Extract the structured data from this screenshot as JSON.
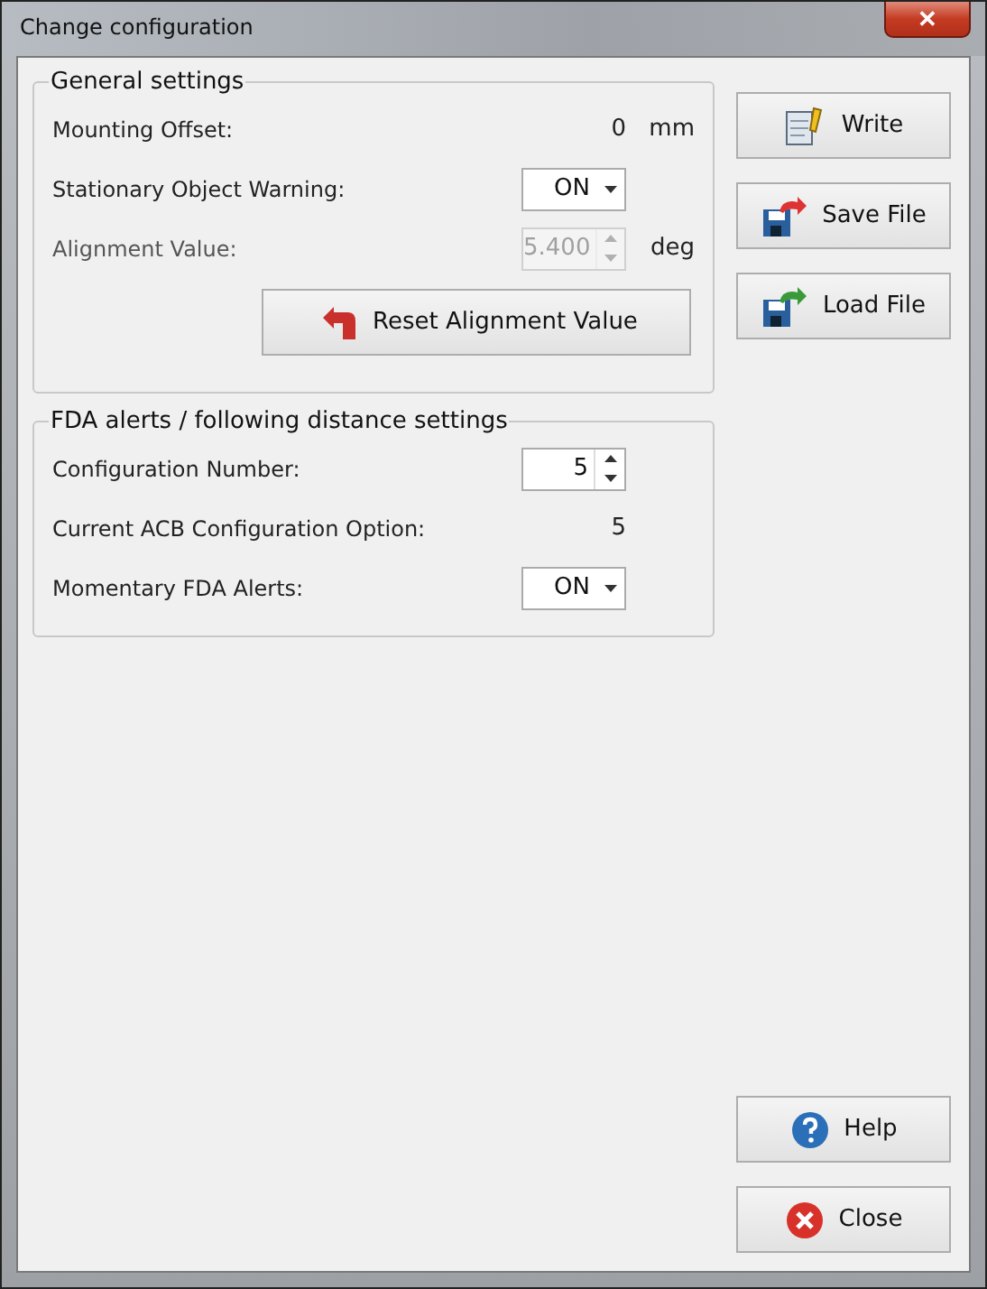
{
  "window": {
    "title": "Change configuration",
    "close_glyph": "✕"
  },
  "general_settings": {
    "title": "General settings",
    "rows": [
      {
        "kind": "readout",
        "label": "Mounting Offset:",
        "value": "0",
        "unit": "mm"
      },
      {
        "kind": "dropdown",
        "label": "Stationary Object Warning:",
        "value": "ON",
        "disabled": false
      },
      {
        "kind": "spinner",
        "label": "Alignment Value:",
        "value": "5.400",
        "unit": "deg",
        "disabled": true
      }
    ],
    "button": {
      "label": "Reset Alignment Value"
    }
  },
  "fda_settings": {
    "title": "FDA alerts / following distance settings",
    "rows": [
      {
        "kind": "spinner",
        "label": "Configuration Number:",
        "value": "5",
        "disabled": false
      },
      {
        "kind": "readout",
        "label": "Current ACB Configuration Option:",
        "value": "5"
      },
      {
        "kind": "dropdown",
        "label": "Momentary FDA Alerts:",
        "value": "ON",
        "disabled": false
      }
    ]
  },
  "side_buttons": [
    {
      "label": "Write"
    },
    {
      "label": "Save File"
    },
    {
      "label": "Load File"
    }
  ],
  "bottom_buttons": [
    {
      "label": "Help"
    },
    {
      "label": "Close"
    }
  ]
}
